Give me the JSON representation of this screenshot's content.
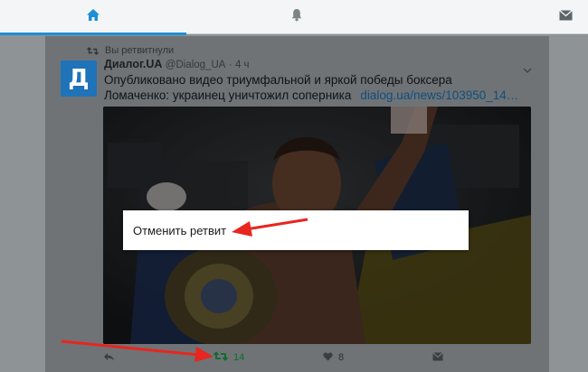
{
  "nav": {
    "tabs": [
      {
        "name": "home",
        "icon": "home-icon",
        "active": true
      },
      {
        "name": "notifications",
        "icon": "bell-icon",
        "active": false
      },
      {
        "name": "messages",
        "icon": "envelope-icon",
        "active": false
      }
    ],
    "accent_color": "#1d8fd6"
  },
  "tweet": {
    "retweet_note": "Вы ретвитнули",
    "avatar_letter": "Д",
    "author": "Диалог.UA",
    "handle": "@Dialog_UA",
    "separator": "·",
    "time": "4 ч",
    "text": "Опубликовано видео триумфальной и яркой победы боксера Ломаченко: украинец уничтожил соперника",
    "link": "dialog.ua/news/103950_14…",
    "actions": {
      "retweet_count": "14",
      "like_count": "8"
    }
  },
  "context_menu": {
    "undo_retweet_label": "Отменить ретвит"
  },
  "colors": {
    "annotation_arrow": "#e8251f",
    "retweeted_active": "#0c6b2e",
    "link": "#0f4e7e"
  }
}
